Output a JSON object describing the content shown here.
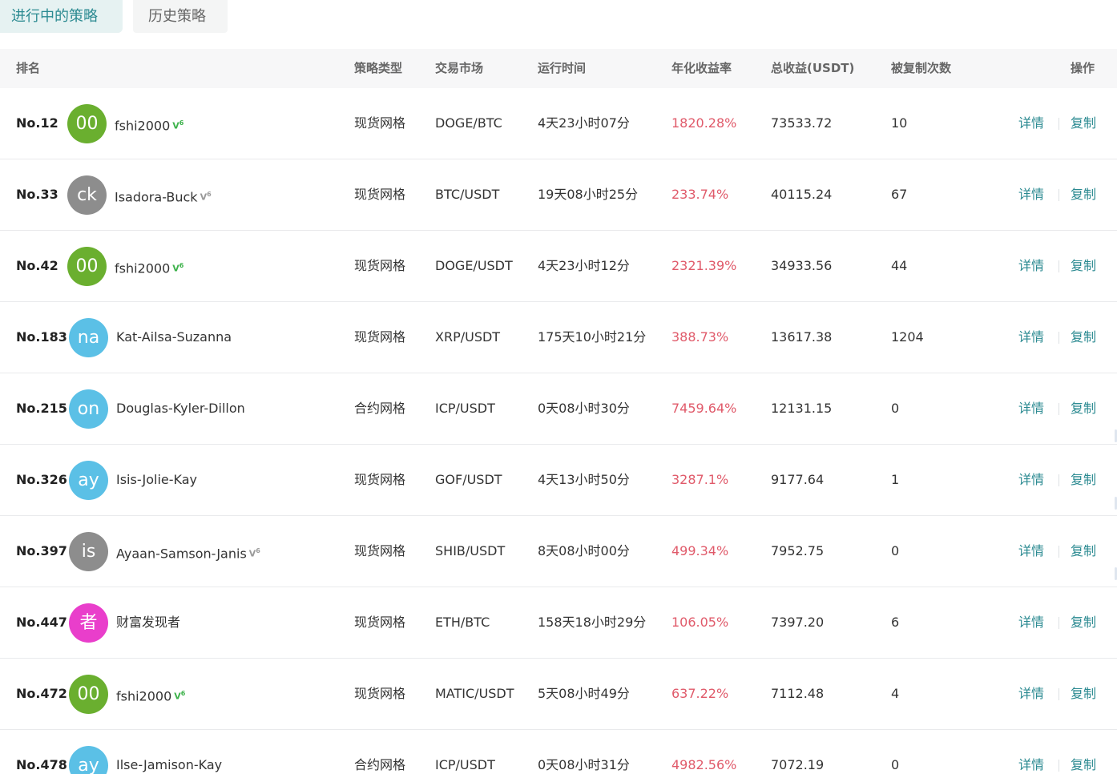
{
  "tabs": {
    "active": "进行中的策略",
    "history": "历史策略"
  },
  "headers": {
    "rank": "排名",
    "type": "策略类型",
    "market": "交易市场",
    "runtime": "运行时间",
    "annual": "年化收益率",
    "total": "总收益(USDT)",
    "copies": "被复制次数",
    "action": "操作"
  },
  "actions": {
    "detail": "详情",
    "copy": "复制"
  },
  "badge_icon": "verified-trader-icon",
  "rows": [
    {
      "rank": "No.12",
      "avatar": "00",
      "avatar_color": "#6aaf2f",
      "name": "fshi2000",
      "badge": "green",
      "type": "现货网格",
      "market": "DOGE/BTC",
      "runtime": "4天23小时07分",
      "annual": "1820.28%",
      "total": "73533.72",
      "copies": "10"
    },
    {
      "rank": "No.33",
      "avatar": "ck",
      "avatar_color": "#8d8d8d",
      "name": "Isadora-Buck",
      "badge": "gray",
      "type": "现货网格",
      "market": "BTC/USDT",
      "runtime": "19天08小时25分",
      "annual": "233.74%",
      "total": "40115.24",
      "copies": "67"
    },
    {
      "rank": "No.42",
      "avatar": "00",
      "avatar_color": "#6aaf2f",
      "name": "fshi2000",
      "badge": "green",
      "type": "现货网格",
      "market": "DOGE/USDT",
      "runtime": "4天23小时12分",
      "annual": "2321.39%",
      "total": "34933.56",
      "copies": "44"
    },
    {
      "rank": "No.183",
      "avatar": "na",
      "avatar_color": "#5bc0e6",
      "name": "Kat-Ailsa-Suzanna",
      "badge": "",
      "type": "现货网格",
      "market": "XRP/USDT",
      "runtime": "175天10小时21分",
      "annual": "388.73%",
      "total": "13617.38",
      "copies": "1204"
    },
    {
      "rank": "No.215",
      "avatar": "on",
      "avatar_color": "#5bc0e6",
      "name": "Douglas-Kyler-Dillon",
      "badge": "",
      "type": "合约网格",
      "market": "ICP/USDT",
      "runtime": "0天08小时30分",
      "annual": "7459.64%",
      "total": "12131.15",
      "copies": "0"
    },
    {
      "rank": "No.326",
      "avatar": "ay",
      "avatar_color": "#5bc0e6",
      "name": "Isis-Jolie-Kay",
      "badge": "",
      "type": "现货网格",
      "market": "GOF/USDT",
      "runtime": "4天13小时50分",
      "annual": "3287.1%",
      "total": "9177.64",
      "copies": "1"
    },
    {
      "rank": "No.397",
      "avatar": "is",
      "avatar_color": "#8d8d8d",
      "name": "Ayaan-Samson-Janis",
      "badge": "gray",
      "type": "现货网格",
      "market": "SHIB/USDT",
      "runtime": "8天08小时00分",
      "annual": "499.34%",
      "total": "7952.75",
      "copies": "0"
    },
    {
      "rank": "No.447",
      "avatar": "者",
      "avatar_color": "#e93ecb",
      "name": "财富发现者",
      "badge": "",
      "type": "现货网格",
      "market": "ETH/BTC",
      "runtime": "158天18小时29分",
      "annual": "106.05%",
      "total": "7397.20",
      "copies": "6"
    },
    {
      "rank": "No.472",
      "avatar": "00",
      "avatar_color": "#6aaf2f",
      "name": "fshi2000",
      "badge": "green",
      "type": "现货网格",
      "market": "MATIC/USDT",
      "runtime": "5天08小时49分",
      "annual": "637.22%",
      "total": "7112.48",
      "copies": "4"
    },
    {
      "rank": "No.478",
      "avatar": "ay",
      "avatar_color": "#5bc0e6",
      "name": "Ilse-Jamison-Kay",
      "badge": "",
      "type": "合约网格",
      "market": "ICP/USDT",
      "runtime": "0天08小时31分",
      "annual": "4982.56%",
      "total": "7072.19",
      "copies": "0"
    }
  ]
}
